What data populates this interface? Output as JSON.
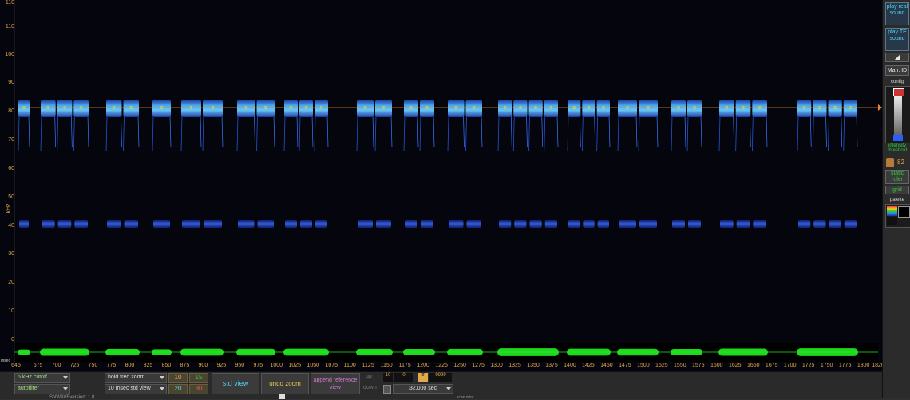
{
  "y_axis": {
    "unit_label": "kHz",
    "ticks": [
      "110",
      "100",
      "90",
      "80",
      "70",
      "60",
      "50",
      "40",
      "30",
      "20",
      "10",
      "0"
    ]
  },
  "x_axis": {
    "unit_label": "msec",
    "ticks": [
      "645",
      "675",
      "700",
      "725",
      "750",
      "775",
      "800",
      "825",
      "850",
      "875",
      "900",
      "925",
      "950",
      "975",
      "1000",
      "1025",
      "1050",
      "1075",
      "1100",
      "1125",
      "1150",
      "1175",
      "1200",
      "1225",
      "1250",
      "1275",
      "1300",
      "1325",
      "1350",
      "1375",
      "1400",
      "1425",
      "1450",
      "1475",
      "1500",
      "1525",
      "1550",
      "1575",
      "1600",
      "1625",
      "1650",
      "1675",
      "1700",
      "1725",
      "1750",
      "1775",
      "1800",
      "1820"
    ]
  },
  "right_panel": {
    "play_real_sound": "play real sound",
    "play_te_sound": "play TE sound",
    "man_id": "Man. ID",
    "config": "config",
    "intensity_threshold": "intensity threshold",
    "threshold_value": "82",
    "static_ruler": "static ruler",
    "grid": "grid",
    "palette": "palette"
  },
  "bottom_panel": {
    "cutoff_select": "5 kHz cutoff",
    "autofilter_select": "autofilter",
    "hold_freq_zoom": "hold freq zoom",
    "std_view_select": "10 msec std view",
    "zoom_10": "10",
    "zoom_15": "15",
    "zoom_20": "20",
    "zoom_30": "30",
    "std_view_button": "std view",
    "undo_zoom_button": "undo zoom",
    "append_reference_view": "append reference view",
    "up_label": "up",
    "down_label": "down",
    "up_value_1": "10",
    "up_value_2": "0",
    "up_value_3": "9999",
    "time_select": "32.000 sec",
    "tf_label": "tf",
    "version_text": "SNWAVEversion: 1.0",
    "status_right": "scan mint"
  },
  "colors": {
    "background": "#05050d",
    "axis_text": "#e3a84a",
    "waveform": "#22ee22",
    "call_main": "#3a7bff",
    "reference_line": "#e88a2a"
  }
}
